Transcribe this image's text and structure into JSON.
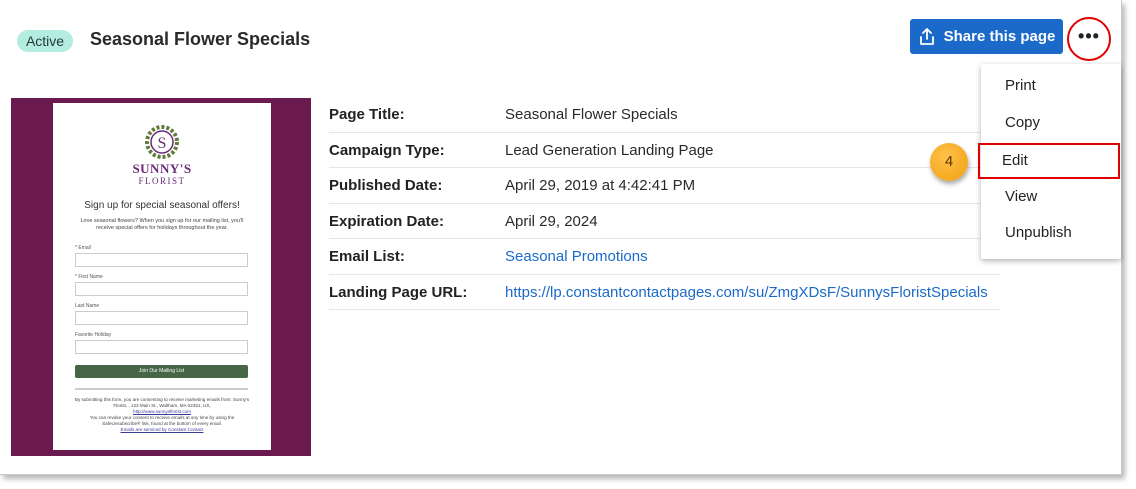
{
  "header": {
    "status": "Active",
    "title": "Seasonal Flower Specials",
    "share_label": "Share this page",
    "more_label": "•••"
  },
  "preview": {
    "brand_name": "SUNNY'S",
    "brand_sub": "FLORIST",
    "heading": "Sign up for special seasonal offers!",
    "intro": "Love seasonal flowers? When you sign up for our mailing list, you'll receive special offers for holidays throughout the year.",
    "fields": [
      "* Email",
      "* First Name",
      "Last Name",
      "Favorite Holiday"
    ],
    "join_label": "Join Our Mailing List",
    "legal_1": "By submitting this form, you are consenting to receive marketing emails from: Sunny's Florist, , 123 Main St., Waltham, MA 02451, US,",
    "legal_link": "http://www.sunnysflorist.com",
    "legal_2": "You can revoke your consent to receive emails at any time by using the SafeUnsubscribe® link, found at the bottom of every email.",
    "legal_3": "Emails are serviced by Constant Contact"
  },
  "details": [
    {
      "label": "Page Title:",
      "value": "Seasonal Flower Specials"
    },
    {
      "label": "Campaign Type:",
      "value": "Lead Generation Landing Page"
    },
    {
      "label": "Published Date:",
      "value": "April 29, 2019 at 4:42:41 PM"
    },
    {
      "label": "Expiration Date:",
      "value": "April 29, 2024"
    },
    {
      "label": "Email List:",
      "value": "Seasonal Promotions"
    },
    {
      "label": "Landing Page URL:",
      "value": "https://lp.constantcontactpages.com/su/ZmgXDsF/SunnysFloristSpecials"
    }
  ],
  "menu": {
    "items": [
      "Print",
      "Copy",
      "Edit",
      "View",
      "Unpublish"
    ]
  },
  "step_badge": "4",
  "colors": {
    "accent": "#1b6ac9",
    "highlight": "#e00000",
    "preview_bg": "#6b1a50",
    "status_bg": "#b4ecdf",
    "step_badge": "#f5a623"
  }
}
